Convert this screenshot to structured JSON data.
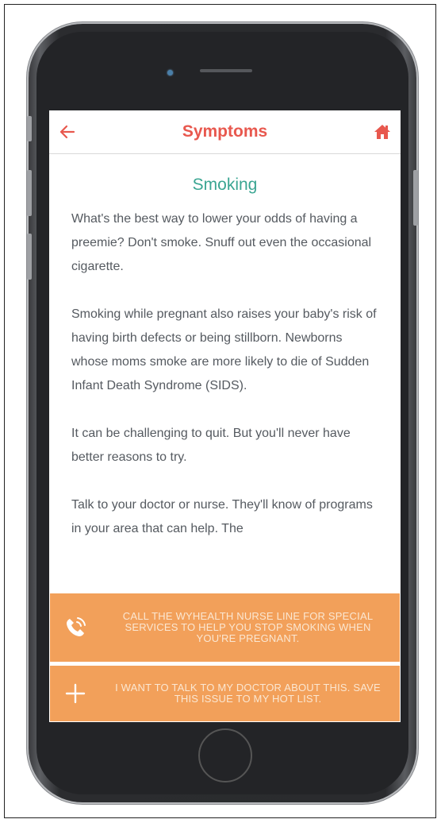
{
  "header": {
    "title": "Symptoms",
    "back_icon": "back-arrow-icon",
    "home_icon": "home-icon"
  },
  "article": {
    "heading": "Smoking",
    "paragraphs": [
      "What's the best way to lower your odds of having a preemie? Don't smoke. Snuff out even the occasional cigarette.",
      "Smoking while pregnant also raises your baby's risk of having birth defects or being stillborn. Newborns whose moms smoke are more likely to die of Sudden Infant Death Syndrome (SIDS).",
      "It can be challenging to quit. But you'll never have better reasons to try.",
      "Talk to your doctor or nurse. They'll know of programs in your area that can help. The"
    ]
  },
  "actions": {
    "call_nurse": {
      "label": "CALL THE WYHEALTH NURSE LINE FOR SPECIAL SERVICES TO HELP YOU STOP SMOKING WHEN YOU'RE PREGNANT.",
      "icon": "phone-icon"
    },
    "add_hotlist": {
      "label": "I WANT TO TALK TO MY DOCTOR ABOUT THIS. SAVE THIS ISSUE TO MY HOT LIST.",
      "icon": "plus-icon"
    }
  },
  "colors": {
    "accent_red": "#e8584e",
    "heading_teal": "#3aa592",
    "cta_orange": "#f2a05a",
    "body_text": "#555a60"
  }
}
